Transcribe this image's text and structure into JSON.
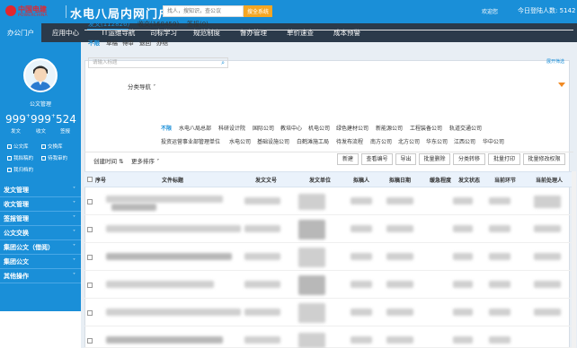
{
  "header": {
    "logo_cn": "中国电建",
    "logo_en": "POWERCHINA",
    "title": "水电八局内网门户",
    "search_placeholder": "找人，搜知识，查公议",
    "search_button": "搜全系统",
    "welcome": "欢迎您",
    "login_count_label": "今日登陆人数:",
    "login_count": "5142"
  },
  "nav": [
    "办公门户",
    "应用中心",
    "IT运维导航",
    "司标学习",
    "规范制度",
    "督办管理",
    "单价速查",
    "成本预警"
  ],
  "nav_active": "办公门户",
  "sidebar": {
    "user_label": "公文管理",
    "stats": [
      {
        "value": "999",
        "sup": "+",
        "label": "发文"
      },
      {
        "value": "999",
        "sup": "+",
        "label": "收文"
      },
      {
        "value": "524",
        "sup": "",
        "label": "签报"
      }
    ],
    "quick_links": [
      "公文库",
      "交换库",
      "我拟稿的",
      "待我审的",
      "我归档的"
    ],
    "menu": [
      "发文管理",
      "收文管理",
      "签报管理",
      "公文交换",
      "集团公文（借阅）",
      "集团公文",
      "其他操作"
    ]
  },
  "tabs": [
    {
      "label": "发文(112826)",
      "active": true
    },
    {
      "label": "收文(168459)",
      "active": false
    },
    {
      "label": "签报(0)",
      "active": false
    }
  ],
  "filters": [
    "不限",
    "草稿",
    "待审",
    "退回",
    "办结"
  ],
  "query_placeholder": "请输入标题",
  "expand_label": "展开筛选",
  "category_label": "分类导航",
  "categories_row1": [
    "不限",
    "水电八局总部",
    "科研设计院",
    "国际公司",
    "教培中心",
    "机电公司",
    "绿色建材公司",
    "新能源公司",
    "工程装备公司",
    "轨道交通公司"
  ],
  "categories_row2": [
    "投资运营事业部管理单位",
    "水电公司",
    "基础设施公司",
    "白鹤滩施工局",
    "待发布流程",
    "南方公司",
    "北方公司",
    "华东公司",
    "江西公司",
    "华中公司"
  ],
  "sort": {
    "created": "创建时间",
    "more": "更多排序"
  },
  "toolbar_buttons": [
    "新建",
    "查看编号",
    "导出",
    "批量删除",
    "分类转移",
    "批量打印",
    "批量修改权限"
  ],
  "table_headers": [
    "序号",
    "文件标题",
    "发文文号",
    "发文单位",
    "拟稿人",
    "拟稿日期",
    "缓急程度",
    "发文状态",
    "当前环节",
    "当前处理人"
  ],
  "colors": {
    "primary": "#1a8fd8",
    "nav_bg": "#2b3a4a",
    "accent": "#f5a623",
    "logo_red": "#e3262d"
  }
}
